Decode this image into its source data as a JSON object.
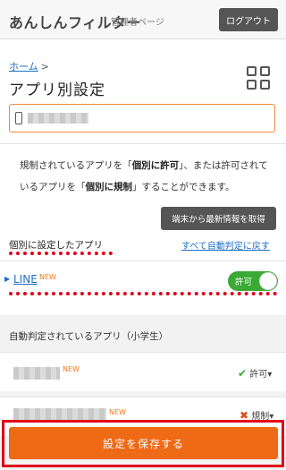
{
  "header": {
    "brand": "あんしんフィルター",
    "subtitle": "管理者ページ",
    "logout_label": "ログアウト"
  },
  "breadcrumb": {
    "home": "ホーム",
    "separator": ">"
  },
  "page": {
    "title": "アプリ別設定"
  },
  "grid_icon": "grid-icon",
  "device_selector": {
    "icon": "smartphone-icon",
    "selected_device": ""
  },
  "description": {
    "part1": "規制されているアプリを「",
    "bold1": "個別に許可",
    "part2": "」、または許可されているアプリを「",
    "bold2": "個別に規制",
    "part3": "」することができます。"
  },
  "refresh_button": "端末から最新情報を取得",
  "individual_section": {
    "label": "個別に設定したアプリ",
    "reset_link": "すべて自動判定に戻す",
    "apps": [
      {
        "name": "LINE",
        "badge": "NEW",
        "toggle_label": "許可",
        "allowed": true
      }
    ]
  },
  "auto_section": {
    "label": "自動判定されているアプリ（小学生）",
    "apps": [
      {
        "name": "",
        "badge": "NEW",
        "status": "許可",
        "status_icon": "check-icon"
      },
      {
        "name": "",
        "badge": "NEW",
        "status": "規制",
        "status_icon": "x-icon"
      }
    ]
  },
  "save_button": "設定を保存する",
  "colors": {
    "accent": "#ee6a17",
    "link": "#1f6fc6",
    "toggle_on": "#3aaa35",
    "highlight": "#e0001a"
  }
}
